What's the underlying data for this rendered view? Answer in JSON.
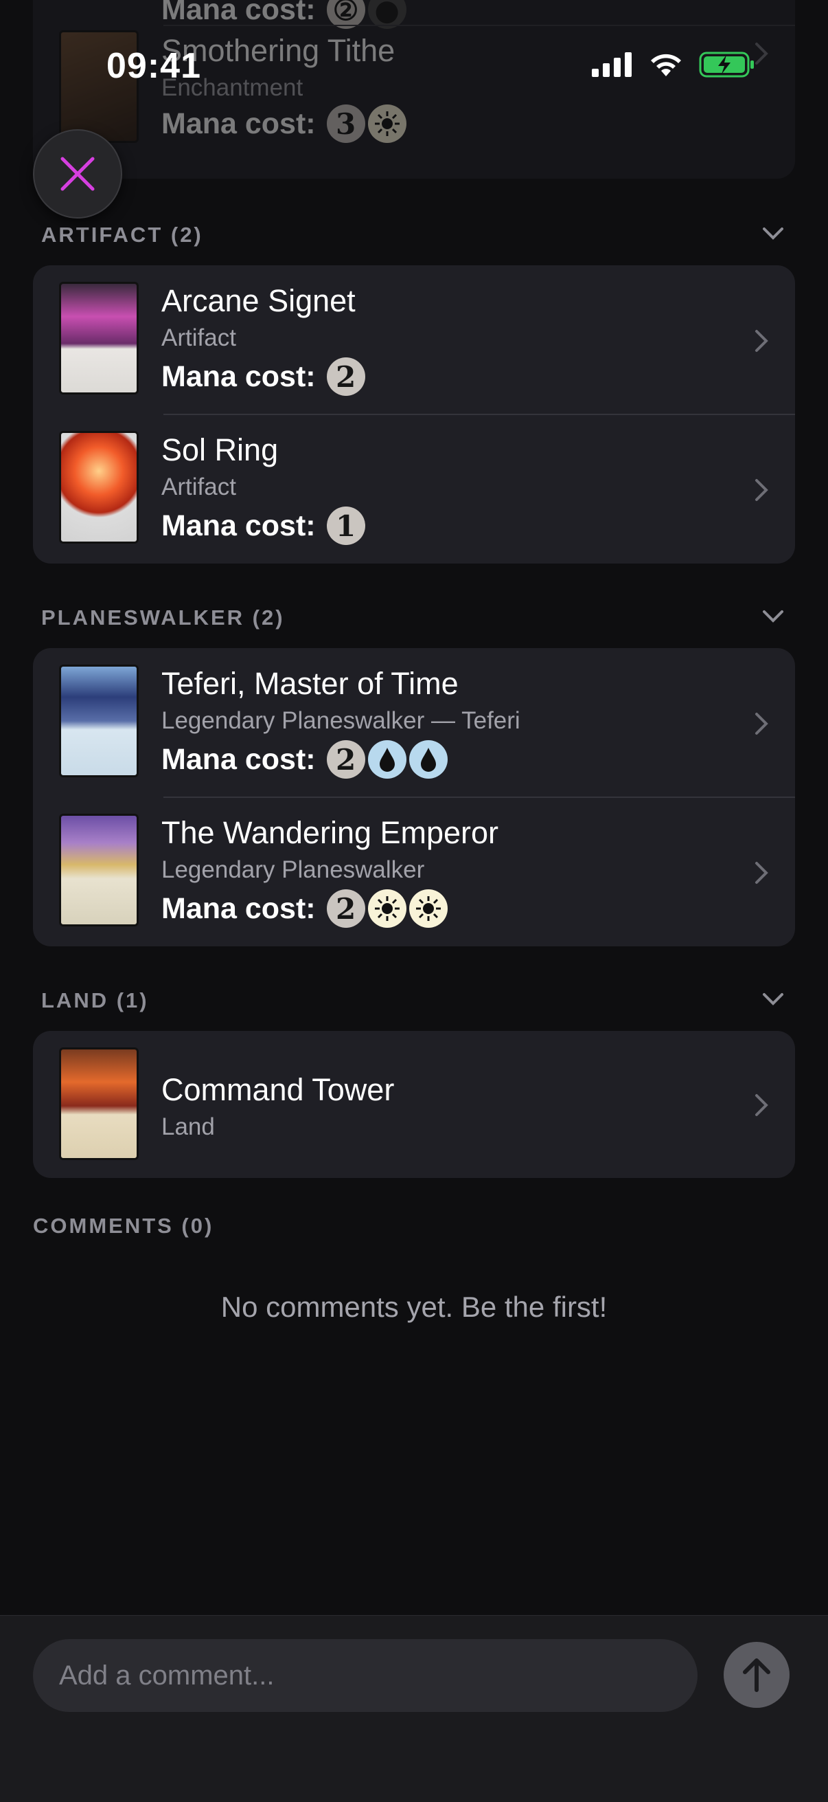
{
  "status_bar": {
    "time": "09:41"
  },
  "close_button_label": "Close",
  "partial_top": {
    "mana_label": "Mana cost:",
    "card": {
      "name": "Smothering Tithe",
      "type": "Enchantment",
      "mana_label": "Mana cost:",
      "mana": [
        "3",
        "W"
      ]
    }
  },
  "sections": [
    {
      "header": "ARTIFACT (2)",
      "cards": [
        {
          "name": "Arcane Signet",
          "type": "Artifact",
          "mana_label": "Mana cost:",
          "mana": [
            "2"
          ]
        },
        {
          "name": "Sol Ring",
          "type": "Artifact",
          "mana_label": "Mana cost:",
          "mana": [
            "1"
          ]
        }
      ]
    },
    {
      "header": "PLANESWALKER (2)",
      "cards": [
        {
          "name": "Teferi, Master of Time",
          "type": "Legendary Planeswalker — Teferi",
          "mana_label": "Mana cost:",
          "mana": [
            "2",
            "U",
            "U"
          ]
        },
        {
          "name": "The Wandering Emperor",
          "type": "Legendary Planeswalker",
          "mana_label": "Mana cost:",
          "mana": [
            "2",
            "W",
            "W"
          ]
        }
      ]
    },
    {
      "header": "LAND (1)",
      "cards": [
        {
          "name": "Command Tower",
          "type": "Land"
        }
      ]
    }
  ],
  "comments": {
    "header": "COMMENTS (0)",
    "empty_text": "No comments yet. Be the first!",
    "input_placeholder": "Add a comment...",
    "send_label": "Send"
  },
  "colors": {
    "background": "#0e0e10",
    "card_group": "#1f1f25",
    "close_accent": "#d63fe0",
    "battery": "#34c759"
  }
}
